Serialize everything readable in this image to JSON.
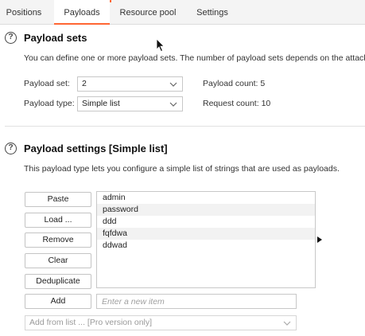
{
  "tabs": [
    {
      "label": "Positions"
    },
    {
      "label": "Payloads"
    },
    {
      "label": "Resource pool"
    },
    {
      "label": "Settings"
    }
  ],
  "payload_sets": {
    "title": "Payload sets",
    "description": "You can define one or more payload sets. The number of payload sets depends on the attack ty",
    "set_label": "Payload set:",
    "set_value": "2",
    "type_label": "Payload type:",
    "type_value": "Simple list",
    "count_label": "Payload count:",
    "count_value": "5",
    "request_label": "Request count:",
    "request_value": "10"
  },
  "payload_settings": {
    "title": "Payload settings [Simple list]",
    "description": "This payload type lets you configure a simple list of strings that are used as payloads.",
    "buttons": {
      "paste": "Paste",
      "load": "Load ...",
      "remove": "Remove",
      "clear": "Clear",
      "deduplicate": "Deduplicate",
      "add": "Add"
    },
    "items": [
      "admin",
      "password",
      "ddd",
      "fqfdwa",
      "ddwad"
    ],
    "new_item_placeholder": "Enter a new item",
    "add_from_list": "Add from list ... [Pro version only]"
  },
  "icons": {
    "help": "help-circle-icon",
    "dropdown": "chevron-down-icon",
    "arrow": "arrow-right-icon",
    "cursor": "mouse-cursor-icon"
  },
  "colors": {
    "accent": "#ff6633"
  }
}
